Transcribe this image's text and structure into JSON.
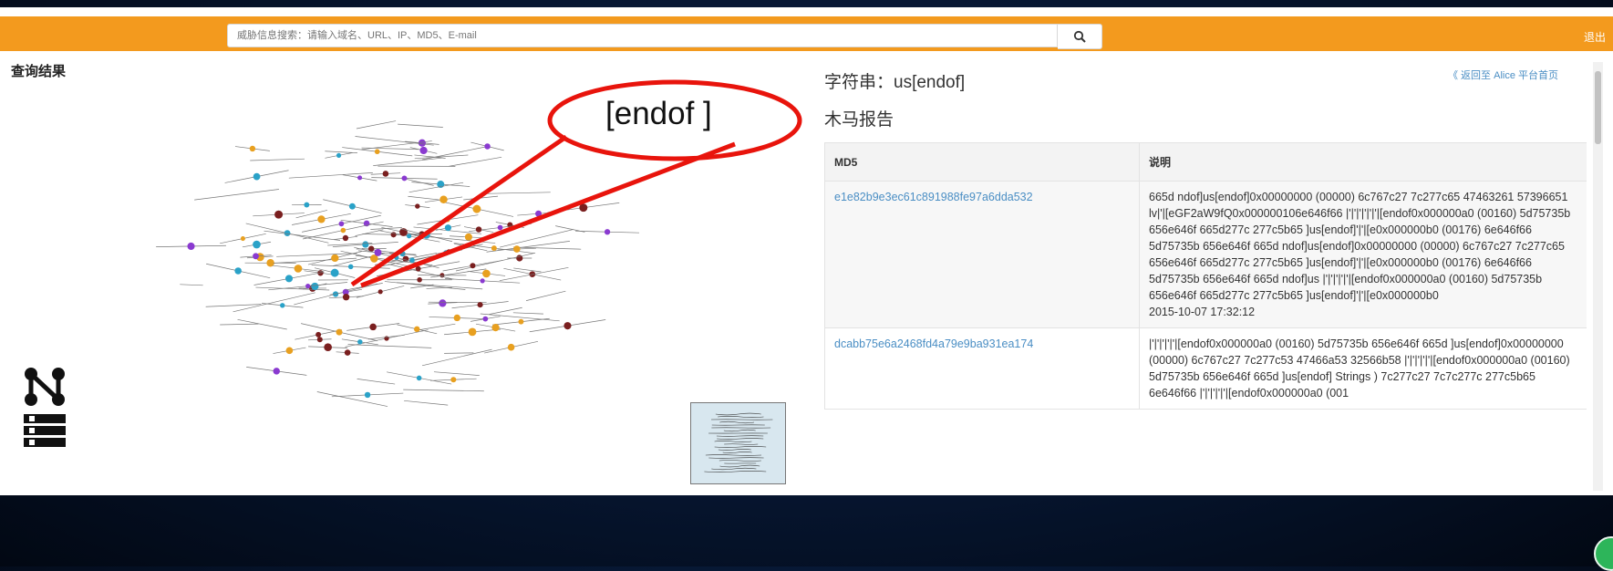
{
  "header": {
    "search_placeholder": "威胁信息搜索：请输入域名、URL、IP、MD5、E-mail",
    "search_icon": "search-icon",
    "logout_label": "退出",
    "accent_color": "#f39a1e"
  },
  "left_panel": {
    "title": "查询结果",
    "callout_label": "[endof ]",
    "callout_color": "#e8140c",
    "node_colors": [
      "#7a1f1f",
      "#8a3ad0",
      "#e8a020",
      "#2aa2c8",
      "#000000"
    ]
  },
  "right_panel": {
    "heading": "字符串：us[endof]",
    "subheading": "木马报告",
    "back_link": "《 返回至 Alice 平台首页",
    "table": {
      "columns": [
        "MD5",
        "说明"
      ],
      "rows": [
        {
          "md5": "e1e82b9e3ec61c891988fe97a6dda532",
          "desc": "665d ndof]us[endof]0x00000000 (00000) 6c767c27 7c277c65 47463261 57396651 lv|'|[eGF2aW9fQ0x000000106e646f66 |'|'|'|'|'|'|[endof0x000000a0 (00160) 5d75735b 656e646f 665d277c 277c5b65 ]us[endof]'|'|[e0x000000b0 (00176) 6e646f66 5d75735b 656e646f 665d ndof]us[endof]0x00000000 (00000) 6c767c27 7c277c65 656e646f 665d277c 277c5b65 ]us[endof]'|'|[e0x000000b0 (00176) 6e646f66 5d75735b 656e646f 665d ndof]us |'|'|'|'|'|[endof0x000000a0 (00160) 5d75735b 656e646f 665d277c 277c5b65 ]us[endof]'|'|[e0x000000b0",
          "date": "2015-10-07 17:32:12"
        },
        {
          "md5": "dcabb75e6a2468fd4a79e9ba931ea174",
          "desc": "|'|'|'|'|'|[endof0x000000a0 (00160) 5d75735b 656e646f 665d ]us[endof]0x00000000 (00000) 6c767c27 7c277c53 47466a53 32566b58 |'|'|'|'|'|[endof0x000000a0 (00160) 5d75735b 656e646f 665d ]us[endof] Strings ) 7c277c27 7c7c277c 277c5b65 6e646f66 |'|'|'|'|'|[endof0x000000a0 (001",
          "date": ""
        }
      ]
    }
  }
}
